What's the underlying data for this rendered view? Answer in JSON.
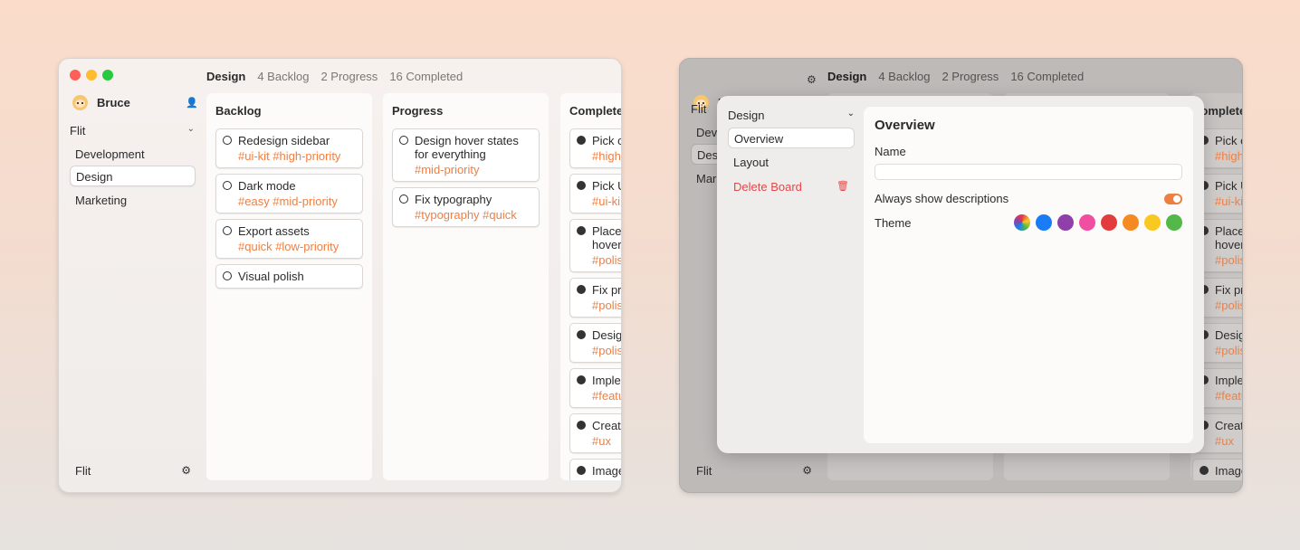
{
  "tabs": {
    "board": "Design",
    "backlog": "4 Backlog",
    "progress": "2 Progress",
    "completed": "16 Completed"
  },
  "user": {
    "name": "Bruce"
  },
  "sidebar": {
    "workspace": "Flit",
    "items": [
      {
        "label": "Development"
      },
      {
        "label": "Design"
      },
      {
        "label": "Marketing"
      }
    ],
    "footer": "Flit"
  },
  "columns": [
    {
      "title": "Backlog",
      "cards": [
        {
          "title": "Redesign sidebar",
          "tags": "#ui-kit  #high-priority"
        },
        {
          "title": "Dark mode",
          "tags": "#easy  #mid-priority"
        },
        {
          "title": "Export assets",
          "tags": "#quick  #low-priority"
        },
        {
          "title": "Visual polish",
          "tags": ""
        }
      ]
    },
    {
      "title": "Progress",
      "cards": [
        {
          "title": "Design hover states for everything",
          "tags": "#mid-priority"
        },
        {
          "title": "Fix typography",
          "tags": "#typography  #quick"
        }
      ]
    },
    {
      "title": "Completed",
      "cards": [
        {
          "title": "Pick c",
          "tags": "#high"
        },
        {
          "title": "Pick U",
          "tags": "#ui-ki"
        },
        {
          "title": "Placel hover",
          "tags": "#polis"
        },
        {
          "title": "Fix pro",
          "tags": "#polis"
        },
        {
          "title": "Desig",
          "tags": "#polis"
        },
        {
          "title": "Impler",
          "tags": "#featu"
        },
        {
          "title": "Create",
          "tags": "#ux"
        },
        {
          "title": "Image",
          "tags": ""
        }
      ]
    }
  ],
  "modal": {
    "board": "Design",
    "nav": [
      {
        "label": "Overview"
      },
      {
        "label": "Layout"
      }
    ],
    "delete_label": "Delete Board",
    "title": "Overview",
    "name_label": "Name",
    "name_value": "",
    "descriptions_label": "Always show descriptions",
    "descriptions_on": true,
    "theme_label": "Theme",
    "theme_colors": [
      "multicolor",
      "#1a7cf5",
      "#8e3fa8",
      "#f24ea1",
      "#e23c3c",
      "#f58a22",
      "#f9c921",
      "#52b848"
    ]
  },
  "colors": {
    "accent": "#ee7f43",
    "danger": "#e24848"
  }
}
